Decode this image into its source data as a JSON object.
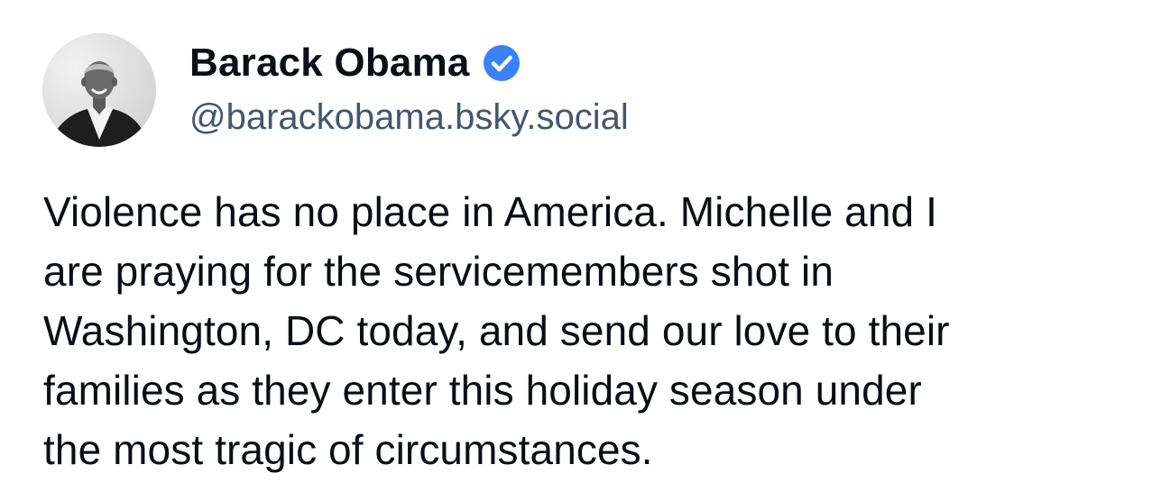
{
  "post": {
    "author": {
      "display_name": "Barack Obama",
      "handle": "@barackobama.bsky.social",
      "verified": true,
      "verified_icon": "verified-check-icon",
      "verified_color": "#3b82f6"
    },
    "text_lines": [
      "Violence has no place in America. Michelle and I",
      "are praying for the servicemembers shot in",
      "Washington, DC today, and send our love to their",
      "families as they enter this holiday season under",
      "the most tragic of circumstances."
    ]
  }
}
